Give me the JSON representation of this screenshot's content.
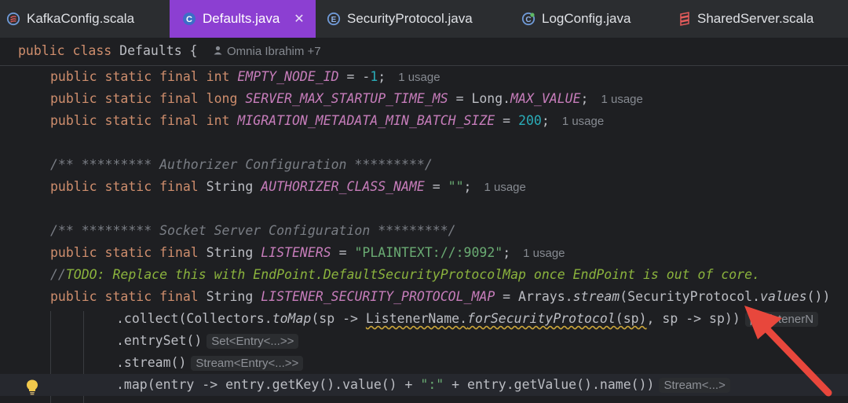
{
  "tabs": [
    {
      "label": "KafkaConfig.scala",
      "icon": "scala-file-icon",
      "active": false
    },
    {
      "label": "Defaults.java",
      "icon": "java-class-icon",
      "active": true
    },
    {
      "label": "SecurityProtocol.java",
      "icon": "java-enum-icon",
      "active": false
    },
    {
      "label": "LogConfig.java",
      "icon": "java-class-icon",
      "active": false
    },
    {
      "label": "SharedServer.scala",
      "icon": "scala-file-icon",
      "active": false
    }
  ],
  "tab_close_glyph": "✕",
  "sticky": {
    "code_kw": "public class",
    "code_name": "Defaults {",
    "author": "Omnia Ibrahim +7"
  },
  "usage_label": "1 usage",
  "code": {
    "l1": {
      "kw": "public static final int",
      "name": "EMPTY_NODE_ID",
      "eq": " = -",
      "num": "1",
      "end": ";"
    },
    "l2": {
      "kw": "public static final long",
      "name": "SERVER_MAX_STARTUP_TIME_MS",
      "eq": " = Long.",
      "const": "MAX_VALUE",
      "end": ";"
    },
    "l3": {
      "kw": "public static final int",
      "name": "MIGRATION_METADATA_MIN_BATCH_SIZE",
      "eq": " = ",
      "num": "200",
      "end": ";"
    },
    "l5": "/** ********* Authorizer Configuration *********/",
    "l6": {
      "kw": "public static final",
      "type": " String ",
      "name": "AUTHORIZER_CLASS_NAME",
      "eq": " = ",
      "str": "\"\"",
      "end": ";"
    },
    "l8": "/** ********* Socket Server Configuration *********/",
    "l9": {
      "kw": "public static final",
      "type": " String ",
      "name": "LISTENERS",
      "eq": " = ",
      "str": "\"PLAINTEXT://:9092\"",
      "end": ";"
    },
    "l10": {
      "slashes": "//",
      "text": "TODO: Replace this with EndPoint.DefaultSecurityProtocolMap once EndPoint is out of core."
    },
    "l11": {
      "kw": "public static final",
      "type": " String ",
      "name": "LISTENER_SECURITY_PROTOCOL_MAP",
      "eq": " = Arrays.",
      "m1": "stream",
      "p1": "(SecurityProtocol.",
      "m2": "values",
      "p2": "())"
    },
    "l12": {
      "a": ".collect(Collectors.",
      "m1": "toMap",
      "b": "(sp -> ",
      "sq": "ListenerName.",
      "m2": "forSecurityProtocol",
      "c": "(sp)",
      "d": ", sp -> sp))",
      "hint": "p<ListenerN"
    },
    "l13": {
      "code": ".entrySet()",
      "hint": "Set<Entry<...>>"
    },
    "l14": {
      "code": ".stream()",
      "hint": "Stream<Entry<...>>"
    },
    "l15": {
      "code": ".map(entry -> entry.getKey().value() + ",
      "str": "\":\"",
      "code2": " + entry.getValue().name())",
      "hint": "Stream<...>"
    }
  },
  "colors": {
    "active_tab": "#8c3fd2",
    "keyword": "#cf8e6d",
    "constant": "#c77dbb",
    "number": "#2aacb8",
    "string": "#6aab73",
    "todo": "#8bb33d",
    "annotation_arrow": "#e8473c"
  }
}
